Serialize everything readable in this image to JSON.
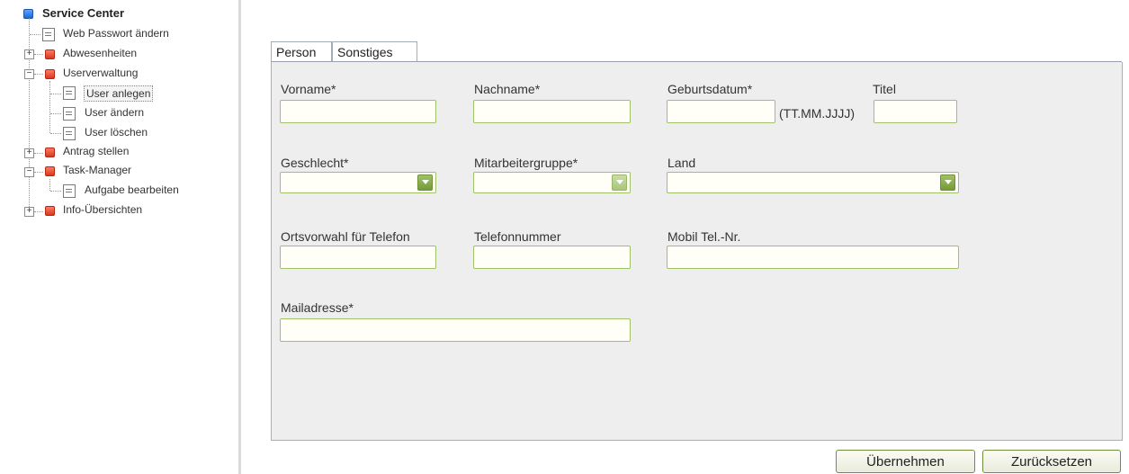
{
  "tree": {
    "root": "Service Center",
    "web_passwort": "Web Passwort ändern",
    "abwesenheiten": "Abwesenheiten",
    "userverwaltung": "Userverwaltung",
    "user_anlegen": "User anlegen",
    "user_aendern": "User ändern",
    "user_loeschen": "User löschen",
    "antrag_stellen": "Antrag stellen",
    "task_manager": "Task-Manager",
    "aufgabe_bearbeiten": "Aufgabe bearbeiten",
    "info_uebersichten": "Info-Übersichten",
    "expand_plus": "+",
    "collapse_minus": "−"
  },
  "tabs": {
    "person": "Person",
    "sonstiges": "Sonstiges"
  },
  "form": {
    "vorname": {
      "label": "Vorname*",
      "value": ""
    },
    "nachname": {
      "label": "Nachname*",
      "value": ""
    },
    "geburtsdatum": {
      "label": "Geburtsdatum*",
      "value": "",
      "hint": "(TT.MM.JJJJ)"
    },
    "titel": {
      "label": "Titel",
      "value": ""
    },
    "geschlecht": {
      "label": "Geschlecht*",
      "selected": ""
    },
    "mitarbeitergruppe": {
      "label": "Mitarbeitergruppe*",
      "selected": ""
    },
    "land": {
      "label": "Land",
      "selected": ""
    },
    "ortsvorwahl": {
      "label": "Ortsvorwahl für Telefon",
      "value": ""
    },
    "telefonnummer": {
      "label": "Telefonnummer",
      "value": ""
    },
    "mobil": {
      "label": "Mobil Tel.-Nr.",
      "value": ""
    },
    "mailadresse": {
      "label": "Mailadresse*",
      "value": ""
    }
  },
  "buttons": {
    "uebernehmen": "Übernehmen",
    "zuruecksetzen": "Zurücksetzen"
  },
  "colors": {
    "field_border": "#9fc16a",
    "panel_bg": "#eeeeee",
    "select_arrow": "#8ab04f"
  }
}
